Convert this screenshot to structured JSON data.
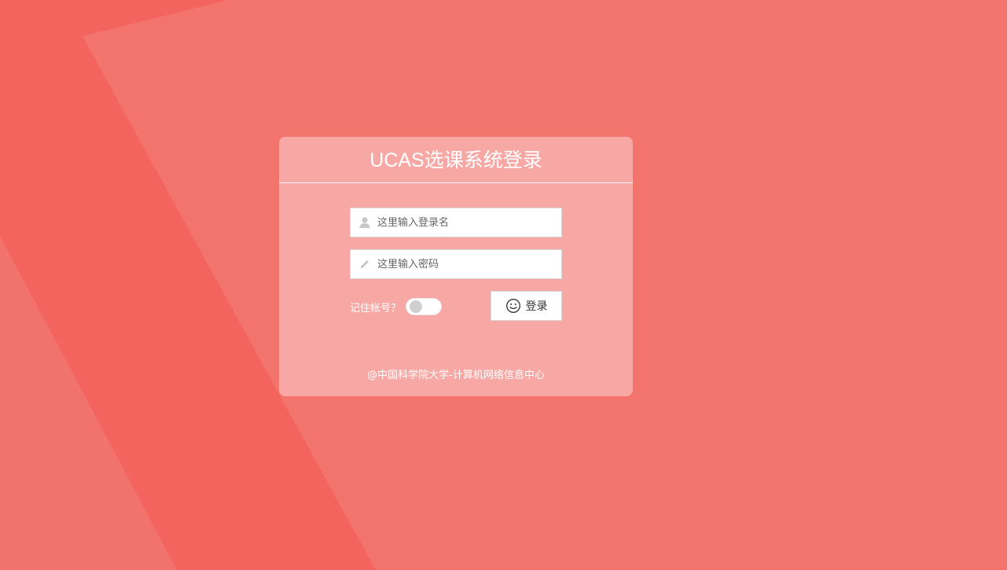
{
  "login": {
    "title": "UCAS选课系统登录",
    "username_placeholder": "这里输入登录名",
    "username_value": "",
    "password_placeholder": "这里输入密码",
    "password_value": "",
    "remember_label": "记住帐号？",
    "remember_on": false,
    "submit_label": "登录",
    "footer": "@中国科学院大学-计算机网络信息中心"
  },
  "icons": {
    "username": "user-icon",
    "password": "pencil-icon",
    "submit": "smile-icon"
  },
  "colors": {
    "background": "#f2736d",
    "background_stripe": "#f4645f",
    "card": "rgba(255,255,255,0.38)",
    "text_light": "#ffffff"
  }
}
